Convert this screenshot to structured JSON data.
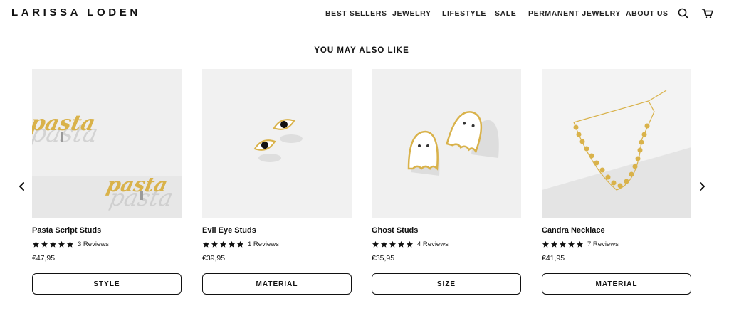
{
  "brand": {
    "logo_text": "LARISSA LODEN"
  },
  "nav": {
    "items": [
      {
        "label": "BEST SELLERS"
      },
      {
        "label": "JEWELRY"
      },
      {
        "label": "LIFESTYLE"
      },
      {
        "label": "SALE"
      },
      {
        "label": "PERMANENT JEWELRY"
      },
      {
        "label": "ABOUT US"
      }
    ],
    "icons": [
      "search-icon",
      "cart-icon"
    ]
  },
  "section": {
    "title": "YOU MAY ALSO LIKE"
  },
  "carousel": {
    "prev_icon": "chevron-left-icon",
    "next_icon": "chevron-right-icon"
  },
  "products": [
    {
      "title": "Pasta Script Studs",
      "rating": 5,
      "reviews": "3 Reviews",
      "price": "€47,95",
      "option_label": "STYLE",
      "image_text": "pasta"
    },
    {
      "title": "Evil Eye Studs",
      "rating": 5,
      "reviews": "1 Reviews",
      "price": "€39,95",
      "option_label": "MATERIAL"
    },
    {
      "title": "Ghost Studs",
      "rating": 5,
      "reviews": "4 Reviews",
      "price": "€35,95",
      "option_label": "SIZE"
    },
    {
      "title": "Candra Necklace",
      "rating": 5,
      "reviews": "7 Reviews",
      "price": "€41,95",
      "option_label": "MATERIAL"
    }
  ],
  "colors": {
    "star": "#111111",
    "gold": "#d9b24a",
    "image_bg": "#ededed"
  }
}
